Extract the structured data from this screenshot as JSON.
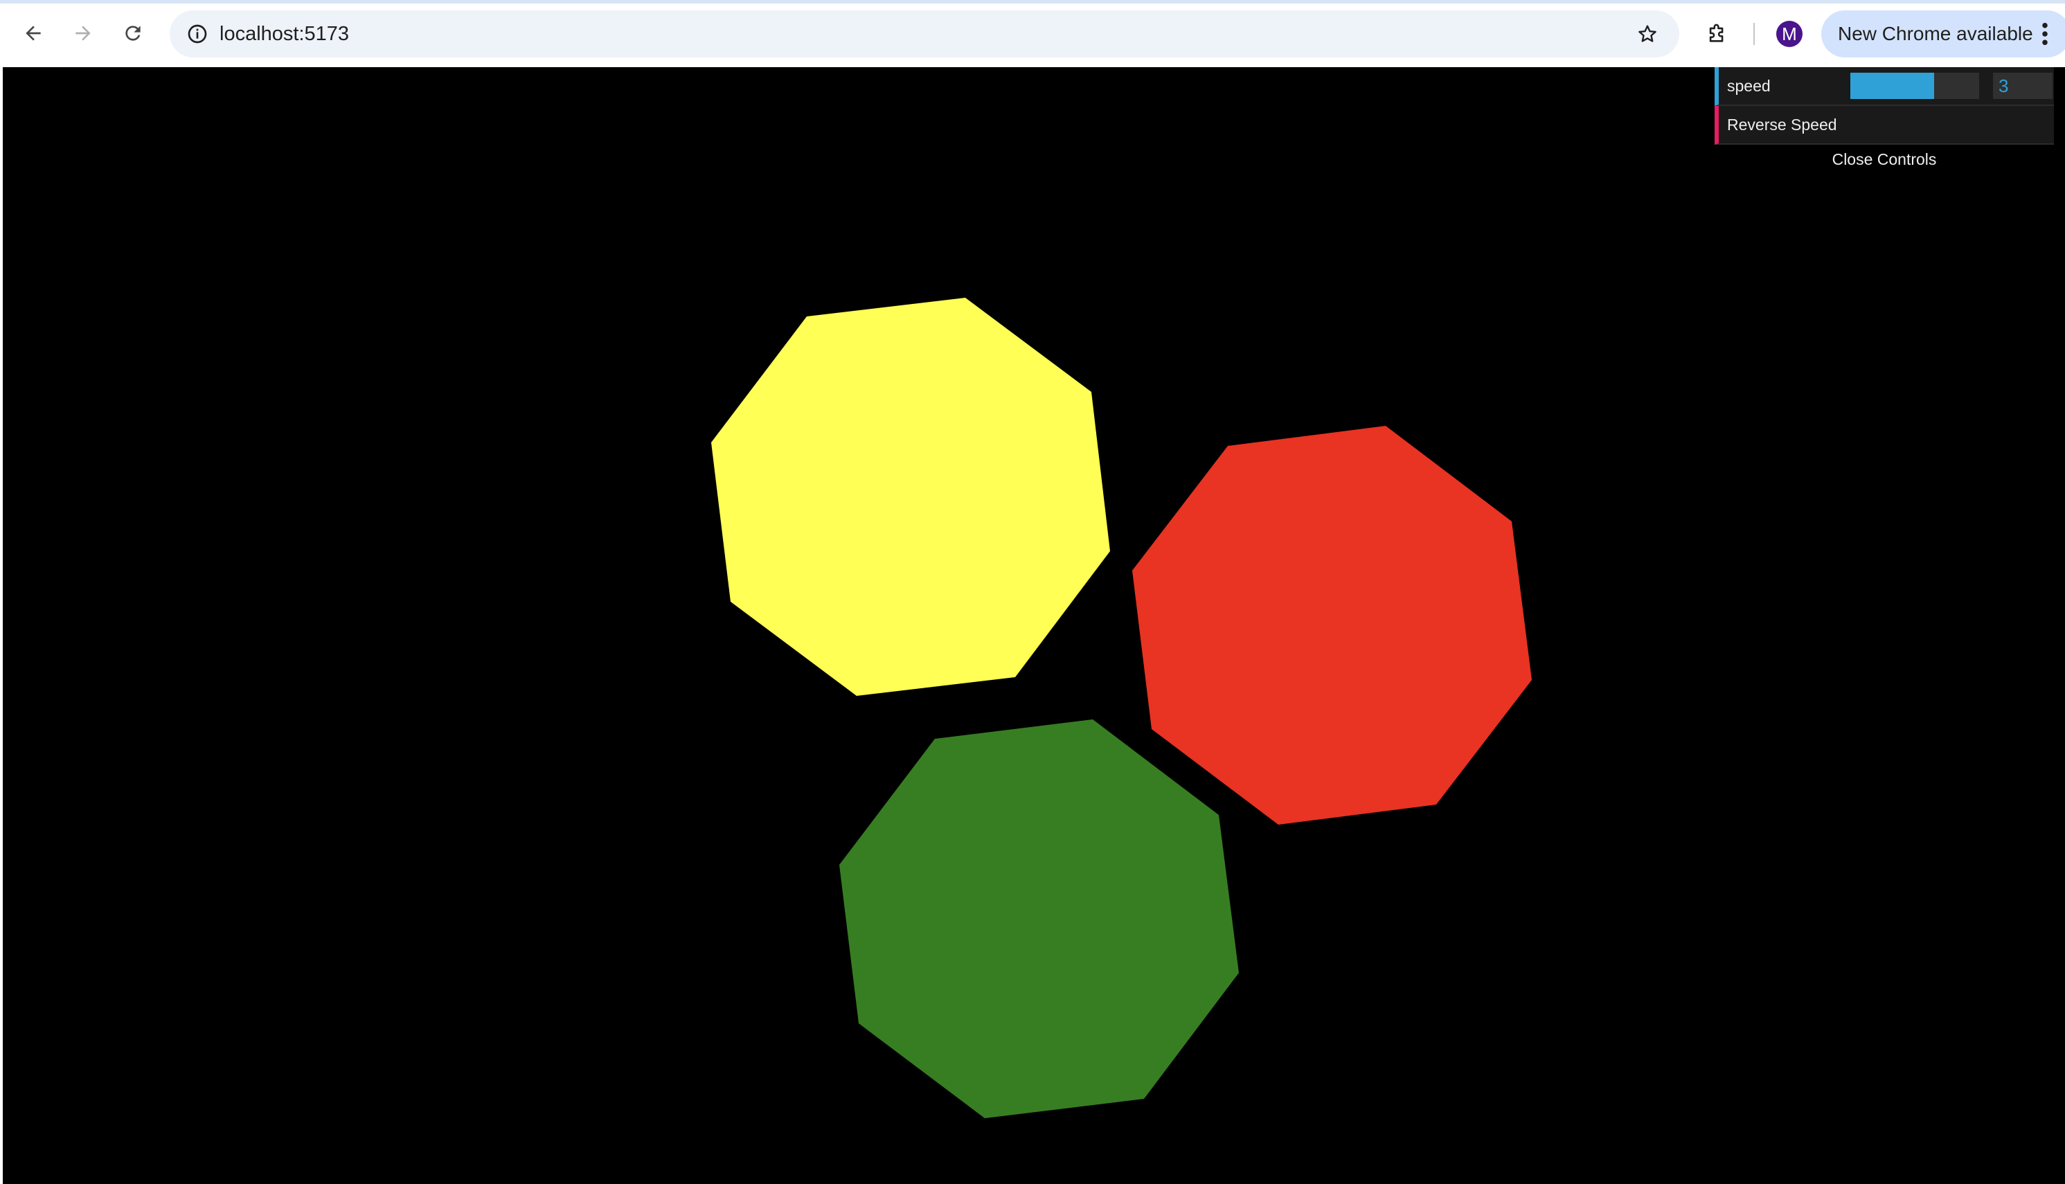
{
  "browser": {
    "url": "localhost:5173",
    "update_label": "New Chrome available",
    "profile_initial": "M",
    "icons": {
      "back": "back-arrow-icon",
      "forward": "forward-arrow-icon",
      "reload": "reload-icon",
      "site_info": "info-icon",
      "bookmark": "star-icon",
      "extensions": "puzzle-icon",
      "menu": "three-dot-menu-icon"
    }
  },
  "controls": {
    "speed_label": "speed",
    "speed_value": "3",
    "speed_fill_fraction": 0.65,
    "reverse_label": "Reverse Speed",
    "close_label": "Close Controls"
  },
  "scene": {
    "background": "#000000",
    "shapes": [
      {
        "name": "yellow-octagon",
        "color": "#ffff55"
      },
      {
        "name": "red-octagon",
        "color": "#e93323"
      },
      {
        "name": "green-octagon",
        "color": "#377e22"
      }
    ]
  }
}
